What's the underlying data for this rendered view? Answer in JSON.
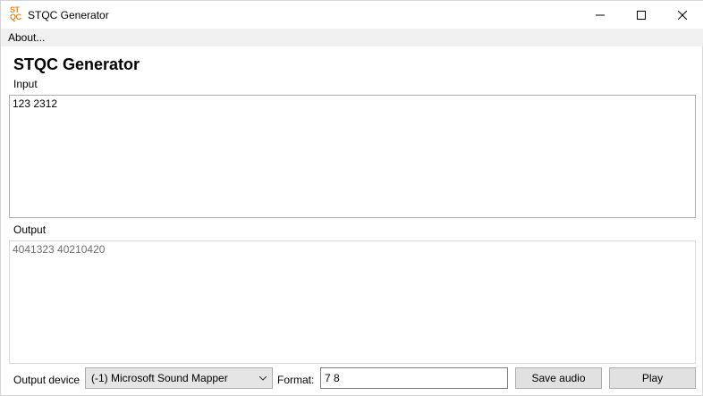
{
  "window": {
    "title": "STQC Generator",
    "icon_top": "ST",
    "icon_bottom": "QC"
  },
  "menu": {
    "about_label": "About..."
  },
  "main": {
    "heading": "STQC Generator",
    "input_label": "Input",
    "input_value": "123 2312",
    "output_label": "Output",
    "output_value": "4041323 40210420"
  },
  "footer": {
    "device_label": "Output device",
    "device_selected": "(-1) Microsoft Sound Mapper",
    "format_label": "Format:",
    "format_value": "7 8",
    "save_label": "Save audio",
    "play_label": "Play"
  },
  "icons": {
    "minimize": "minimize-icon",
    "maximize": "maximize-icon",
    "close": "close-icon",
    "dropdown": "chevron-down-icon"
  },
  "colors": {
    "accent_icon": "#e08a2a",
    "menubar_bg": "#f0f0f0",
    "button_bg": "#e1e1e1"
  }
}
